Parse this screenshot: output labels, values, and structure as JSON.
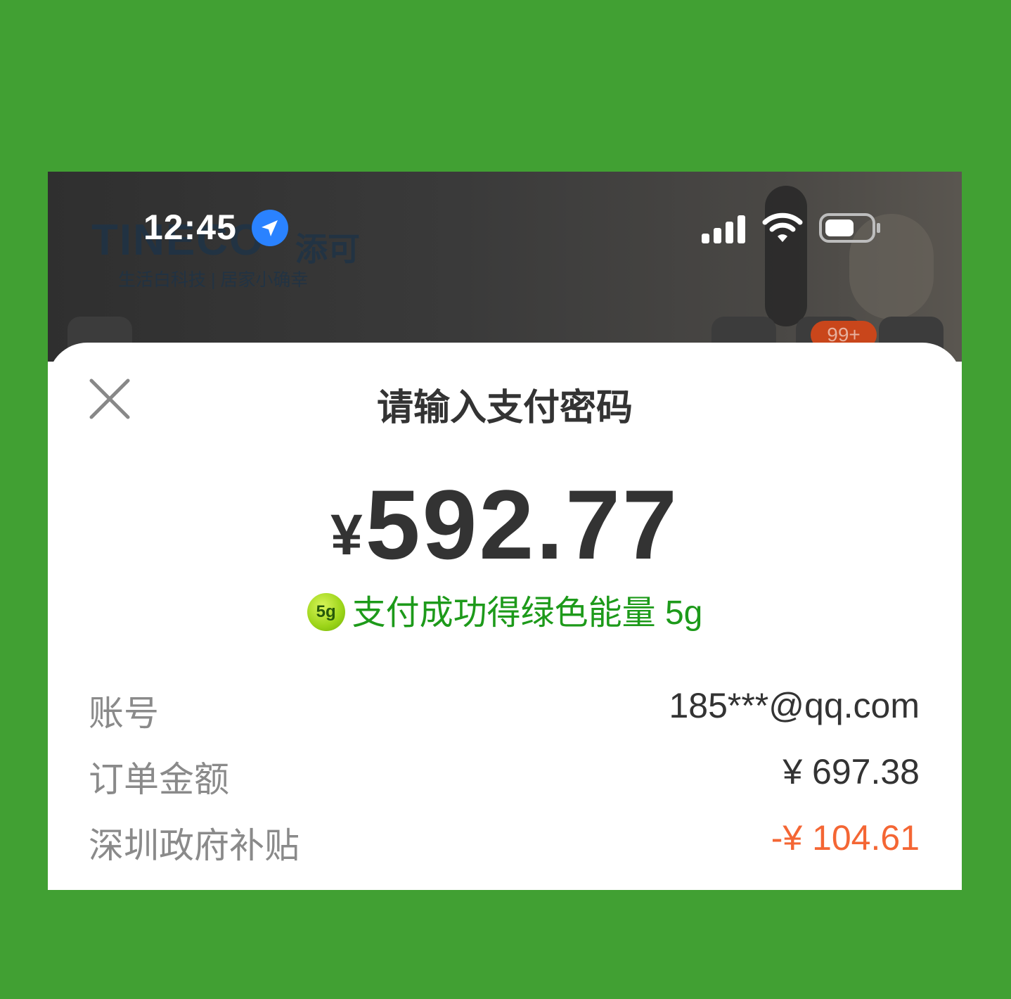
{
  "status_bar": {
    "time": "12:45"
  },
  "background_app": {
    "logo": "TINECO",
    "logo_cn": "添可",
    "slogan": "生活白科技 | 居家小确幸",
    "badge": "99+"
  },
  "sheet": {
    "title": "请输入支付密码",
    "currency_symbol": "¥",
    "amount": "592.77",
    "energy_badge": "5g",
    "energy_text": "支付成功得绿色能量 5g",
    "rows": [
      {
        "label": "账号",
        "value": "185***@qq.com"
      },
      {
        "label": "订单金额",
        "value": "¥ 697.38"
      },
      {
        "label": "深圳政府补贴",
        "value": "-¥ 104.61"
      }
    ]
  },
  "colors": {
    "page_background": "#41a033",
    "energy_green": "#1d9a1a",
    "discount_red": "#f46634",
    "location_blue": "#2a82ff"
  }
}
